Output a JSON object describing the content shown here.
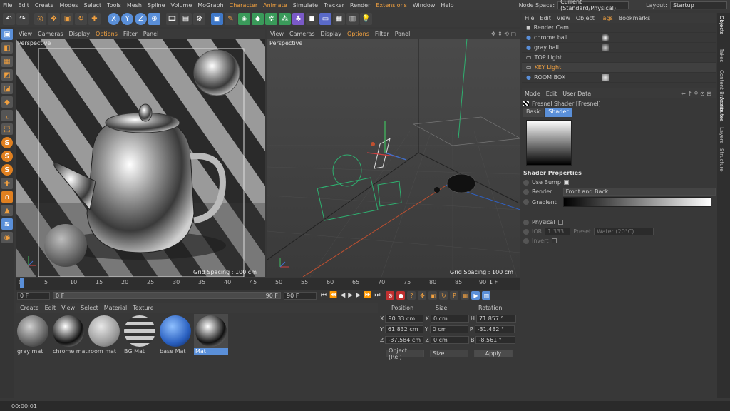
{
  "menu": {
    "items": [
      "File",
      "Edit",
      "Create",
      "Modes",
      "Select",
      "Tools",
      "Mesh",
      "Spline",
      "Volume",
      "MoGraph",
      "Character",
      "Animate",
      "Simulate",
      "Tracker",
      "Render",
      "Extensions",
      "Window",
      "Help"
    ],
    "node_space_label": "Node Space:",
    "node_space_value": "Current (Standard/Physical)",
    "layout_label": "Layout:",
    "layout_value": "Startup"
  },
  "toolbar": {
    "axis_x": "X",
    "axis_y": "Y",
    "axis_z": "Z"
  },
  "viewport_left": {
    "menu": [
      "View",
      "Cameras",
      "Display",
      "Options",
      "Filter",
      "Panel"
    ],
    "name": "Perspective",
    "grid": "Grid Spacing : 100 cm"
  },
  "viewport_right": {
    "menu": [
      "View",
      "Cameras",
      "Display",
      "Options",
      "Filter",
      "Panel"
    ],
    "name": "Perspective",
    "grid": "Grid Spacing : 100 cm"
  },
  "timeline": {
    "ticks": [
      "0",
      "5",
      "10",
      "15",
      "20",
      "25",
      "30",
      "35",
      "40",
      "45",
      "50",
      "55",
      "60",
      "65",
      "70",
      "75",
      "80",
      "85",
      "90"
    ],
    "current_frame": "1 F",
    "start_field": "0 F",
    "start_field2": "0 F",
    "end_field": "90 F",
    "end_field2": "90 F"
  },
  "materials": {
    "menu": [
      "Create",
      "Edit",
      "View",
      "Select",
      "Material",
      "Texture"
    ],
    "items": [
      {
        "label": "gray mat"
      },
      {
        "label": "chrome mat"
      },
      {
        "label": "room mat"
      },
      {
        "label": "BG Mat"
      },
      {
        "label": "base Mat"
      },
      {
        "label": "Mat"
      }
    ]
  },
  "coords": {
    "headers": [
      "Position",
      "Size",
      "Rotation"
    ],
    "rows": [
      {
        "axis": "X",
        "pos": "90.33 cm",
        "size_axis": "X",
        "size": "0 cm",
        "rot_axis": "H",
        "rot": "71.857 °"
      },
      {
        "axis": "Y",
        "pos": "61.832 cm",
        "size_axis": "Y",
        "size": "0 cm",
        "rot_axis": "P",
        "rot": "-31.482 °"
      },
      {
        "axis": "Z",
        "pos": "-37.584 cm",
        "size_axis": "Z",
        "size": "0 cm",
        "rot_axis": "B",
        "rot": "-8.561 °"
      }
    ],
    "mode": "Object (Rel)",
    "size_mode": "Size",
    "apply": "Apply"
  },
  "objects": {
    "menu": [
      "File",
      "Edit",
      "View",
      "Object",
      "Tags",
      "Bookmarks"
    ],
    "rows": [
      "Render Cam",
      "chrome ball",
      "gray ball",
      "TOP Light",
      "KEY Light",
      "ROOM BOX"
    ]
  },
  "attributes": {
    "menu": [
      "Mode",
      "Edit",
      "User Data"
    ],
    "title": "Fresnel Shader [Fresnel]",
    "tab_basic": "Basic",
    "tab_shader": "Shader",
    "section": "Shader Properties",
    "use_bump": "Use Bump",
    "render_label": "Render",
    "render_value": "Front and Back",
    "gradient_label": "Gradient",
    "physical_label": "Physical",
    "ior_label": "IOR",
    "ior_value": "1.333",
    "preset_label": "Preset",
    "preset_value": "Water (20°C)",
    "invert_label": "Invert"
  },
  "right_tabs": [
    "Objects",
    "Takes",
    "Content Browser",
    "Attributes",
    "Layers",
    "Structure"
  ],
  "status": "00:00:01",
  "colors": {
    "accent": "#f0a040",
    "select_blue": "#5a8fd8",
    "bg": "#383838"
  }
}
